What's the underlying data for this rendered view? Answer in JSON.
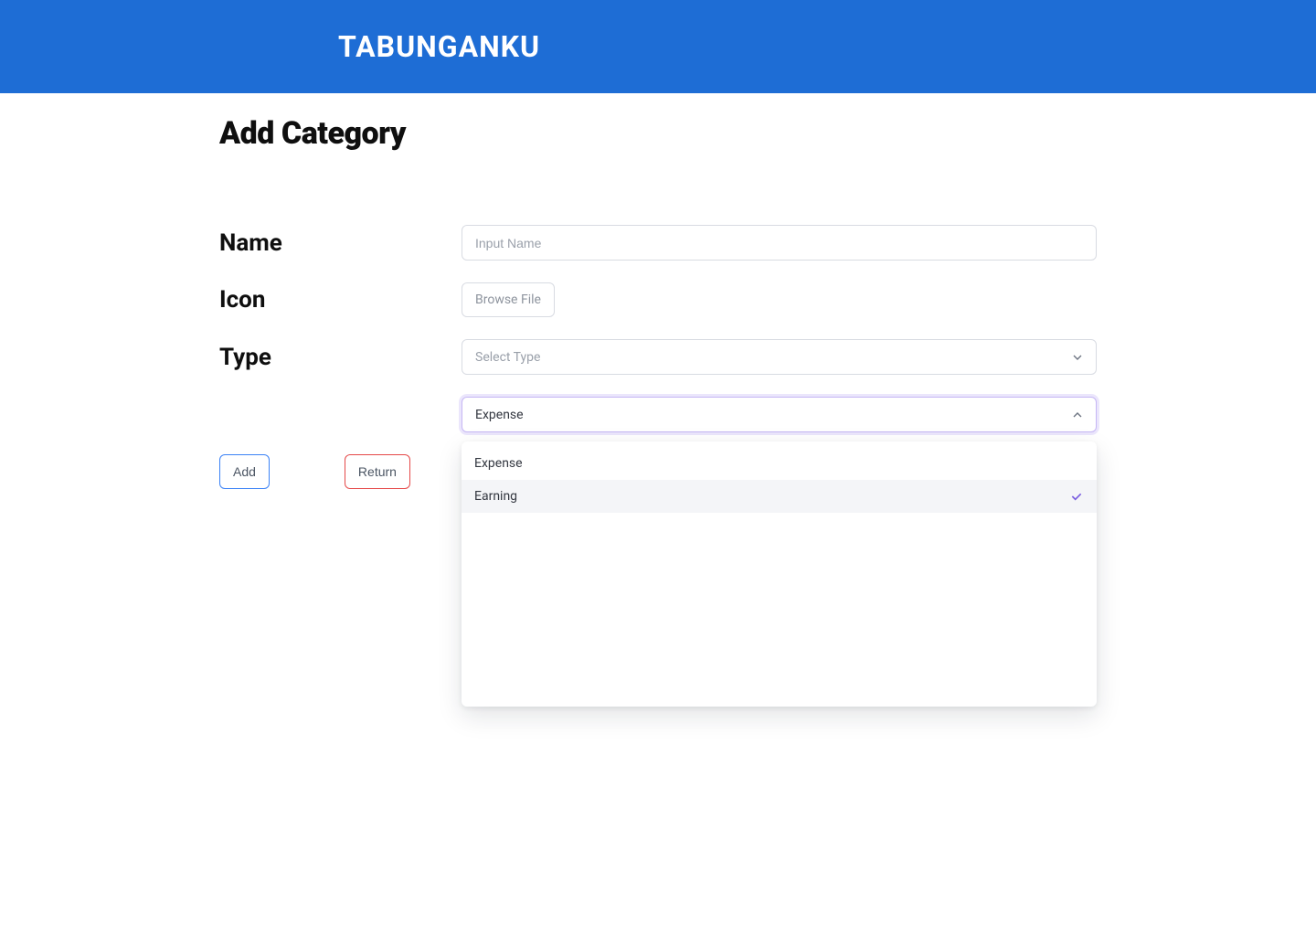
{
  "header": {
    "title": "TABUNGANKU"
  },
  "page": {
    "title": "Add Category"
  },
  "form": {
    "name": {
      "label": "Name",
      "placeholder": "Input Name",
      "value": ""
    },
    "icon": {
      "label": "Icon",
      "browse_label": "Browse File"
    },
    "type": {
      "label": "Type",
      "placeholder": "Select Type",
      "selected": "Expense",
      "options": [
        "Expense",
        "Earning"
      ],
      "highlighted_option": "Earning"
    }
  },
  "actions": {
    "add_label": "Add",
    "return_label": "Return"
  }
}
